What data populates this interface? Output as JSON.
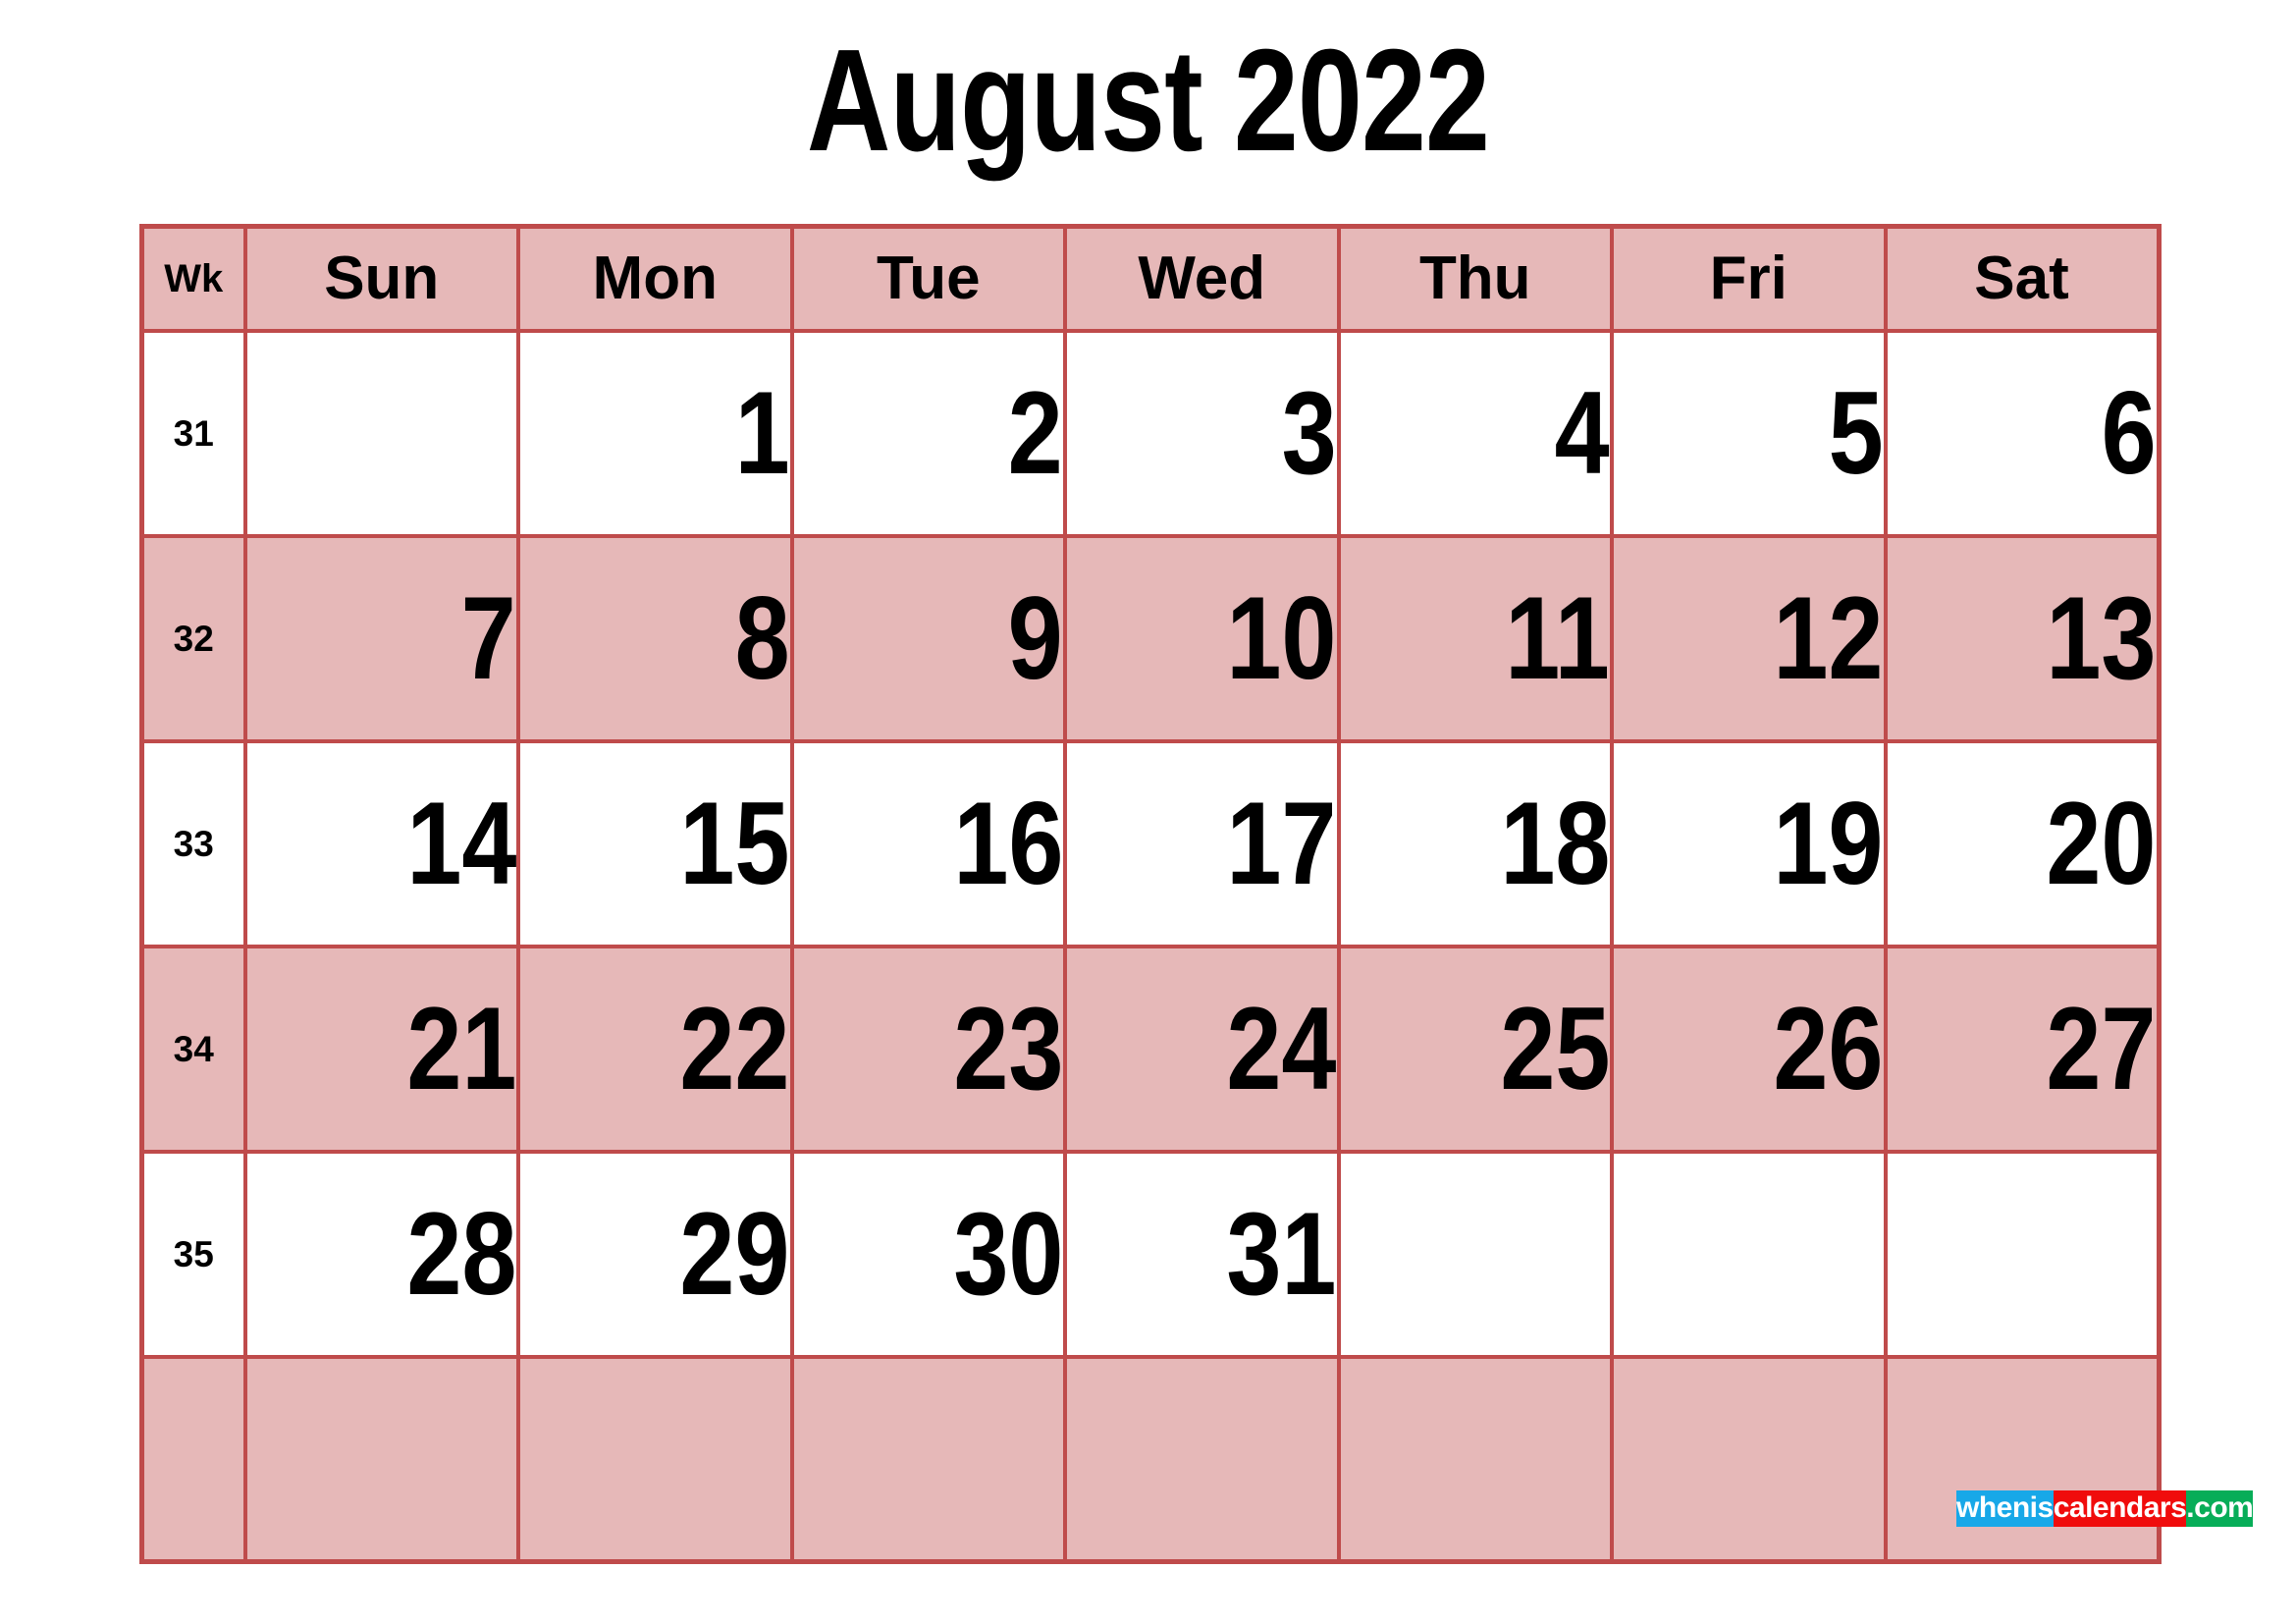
{
  "title": "August 2022",
  "colors": {
    "grid_border": "#bf4b4b",
    "row_pink": "#e6b8b8",
    "row_white": "#ffffff",
    "text": "#000000",
    "watermark_blue": "#18a8e8",
    "watermark_red": "#f00c0c",
    "watermark_green": "#07ad58"
  },
  "header": {
    "week_label": "Wk",
    "days": [
      "Sun",
      "Mon",
      "Tue",
      "Wed",
      "Thu",
      "Fri",
      "Sat"
    ]
  },
  "weeks": [
    {
      "wk": "31",
      "shade": "white",
      "days": [
        "",
        "1",
        "2",
        "3",
        "4",
        "5",
        "6"
      ]
    },
    {
      "wk": "32",
      "shade": "pink",
      "days": [
        "7",
        "8",
        "9",
        "10",
        "11",
        "12",
        "13"
      ]
    },
    {
      "wk": "33",
      "shade": "white",
      "days": [
        "14",
        "15",
        "16",
        "17",
        "18",
        "19",
        "20"
      ]
    },
    {
      "wk": "34",
      "shade": "pink",
      "days": [
        "21",
        "22",
        "23",
        "24",
        "25",
        "26",
        "27"
      ]
    },
    {
      "wk": "35",
      "shade": "white",
      "days": [
        "28",
        "29",
        "30",
        "31",
        "",
        "",
        ""
      ]
    },
    {
      "wk": "",
      "shade": "pink",
      "days": [
        "",
        "",
        "",
        "",
        "",
        "",
        ""
      ]
    }
  ],
  "watermark": {
    "part1": "whenis",
    "part2": "calendars",
    "part3": ".com"
  }
}
